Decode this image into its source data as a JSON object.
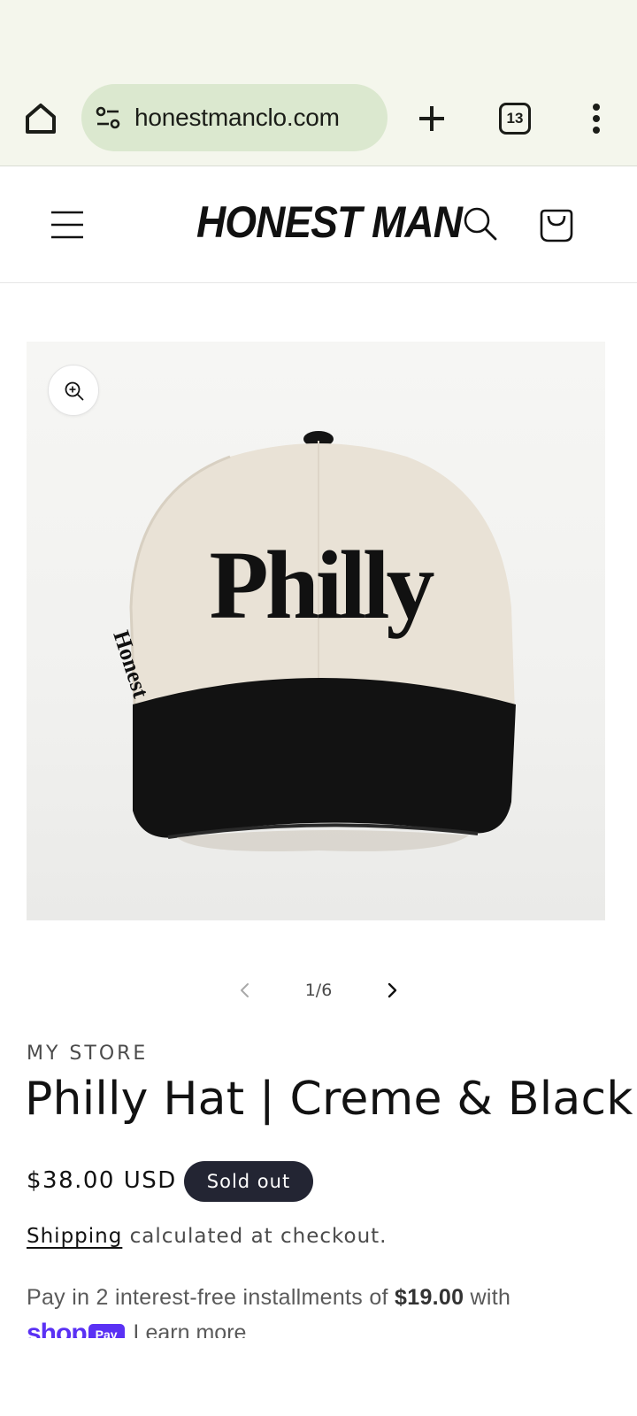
{
  "browser": {
    "url": "honestmanclo.com",
    "tab_count": "13",
    "icons": [
      "home-icon",
      "site-settings-icon",
      "new-tab-icon",
      "tab-switcher-icon",
      "more-options-icon"
    ]
  },
  "header": {
    "logo": "HONEST MAN",
    "icons": [
      "menu-icon",
      "search-icon",
      "cart-icon"
    ]
  },
  "media": {
    "hat_text": "Philly",
    "side_text": "Honest Man",
    "counter": "1/6",
    "icons": [
      "zoom-icon",
      "chevron-left-icon",
      "chevron-right-icon"
    ]
  },
  "product": {
    "vendor": "MY STORE",
    "title": "Philly Hat | Creme & Black",
    "price": "$38.00 USD",
    "badge": "Sold out",
    "shipping_link": "Shipping",
    "shipping_text": " calculated at checkout.",
    "installments_prefix": "Pay in 2 interest-free installments of ",
    "installments_amount": "$19.00",
    "installments_suffix": " with",
    "shop_word": "shop",
    "pay_word": "Pay",
    "learn_more": "Learn more"
  },
  "colors": {
    "chrome_bg": "#f4f6ec",
    "urlbar_bg": "#dbe8cf",
    "badge_bg": "#232533",
    "shop_pay": "#5a31f4"
  }
}
